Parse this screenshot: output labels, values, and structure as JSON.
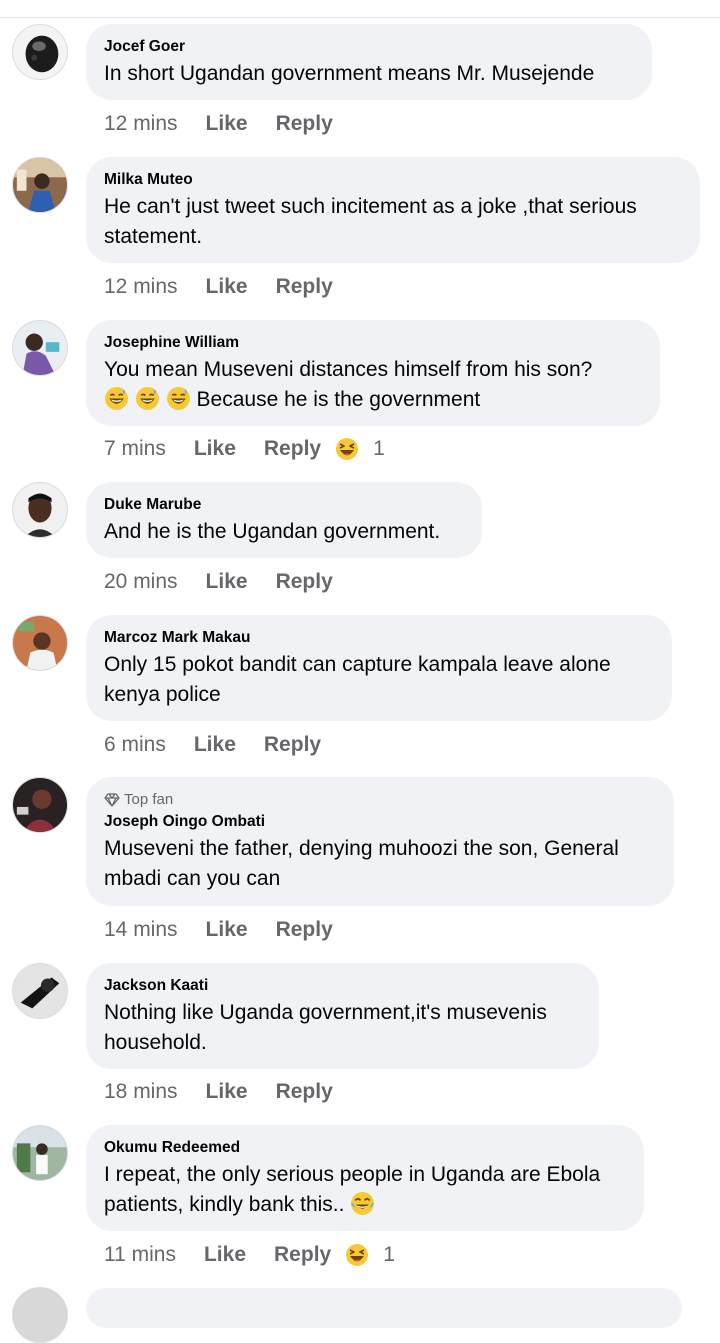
{
  "comments": [
    {
      "author": "Jocef Goer",
      "text": "In short Ugandan government means Mr. Musejende",
      "time": "12 mins",
      "like": "Like",
      "reply": "Reply"
    },
    {
      "author": "Milka Muteo",
      "text_line1": "He can't just tweet such incitement as a joke ,that serious",
      "text_line2": "statement.",
      "time": "12 mins",
      "like": "Like",
      "reply": "Reply"
    },
    {
      "author": "Josephine William",
      "text_line1": "You mean Museveni  distances himself from his son?",
      "text_line2_suffix": "Because he is the government",
      "time": "7 mins",
      "like": "Like",
      "reply": "Reply",
      "reaction_icon": "laughing-emoji-icon",
      "reaction_count": "1"
    },
    {
      "author": "Duke Marube",
      "text": "And he is the Ugandan government.",
      "time": "20 mins",
      "like": "Like",
      "reply": "Reply"
    },
    {
      "author": "Marcoz Mark Makau",
      "text_line1": "Only  15 pokot bandit can capture  kampala leave alone",
      "text_line2": "kenya police",
      "time": "6 mins",
      "like": "Like",
      "reply": "Reply"
    },
    {
      "badge": "Top fan",
      "author": "Joseph Oingo Ombati",
      "text_line1": "Museveni the father, denying muhoozi the son, General",
      "text_line2": "mbadi can you can",
      "time": "14 mins",
      "like": "Like",
      "reply": "Reply"
    },
    {
      "author": "Jackson Kaati",
      "text_line1": "Nothing like Uganda government,it's musevenis",
      "text_line2": "household.",
      "time": "18 mins",
      "like": "Like",
      "reply": "Reply"
    },
    {
      "author": "Okumu Redeemed",
      "text_line1": "I repeat, the only serious people in Uganda are Ebola",
      "text_line2": "patients, kindly bank this..",
      "time": "11 mins",
      "like": "Like",
      "reply": "Reply",
      "reaction_icon": "laughing-emoji-icon",
      "reaction_count": "1"
    }
  ],
  "colors": {
    "bubble": "#f0f2f5",
    "secondary_text": "#65676b",
    "primary_text": "#050505",
    "emoji_yellow": "#f7c936"
  }
}
